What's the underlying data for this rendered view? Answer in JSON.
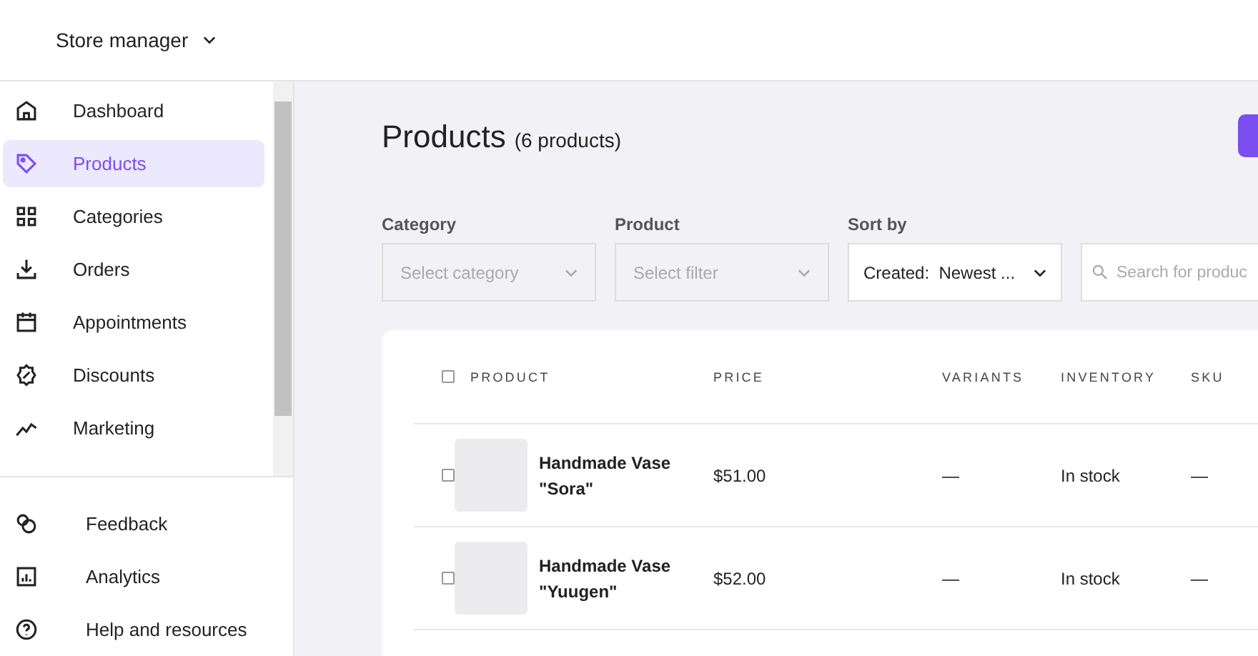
{
  "header": {
    "store_menu": "Store manager"
  },
  "sidebar": {
    "items": [
      {
        "label": "Dashboard",
        "selected": false
      },
      {
        "label": "Products",
        "selected": true
      },
      {
        "label": "Categories",
        "selected": false
      },
      {
        "label": "Orders",
        "selected": false
      },
      {
        "label": "Appointments",
        "selected": false
      },
      {
        "label": "Discounts",
        "selected": false
      },
      {
        "label": "Marketing",
        "selected": false
      }
    ],
    "footer_items": [
      {
        "label": "Feedback"
      },
      {
        "label": "Analytics"
      },
      {
        "label": "Help and resources"
      }
    ]
  },
  "page": {
    "title": "Products",
    "count": "(6 products)"
  },
  "filters": [
    {
      "kind": "select",
      "label": "Category",
      "placeholder": "Select category"
    },
    {
      "kind": "select",
      "label": "Product",
      "placeholder": "Select filter"
    },
    {
      "kind": "sort",
      "label": "Sort by",
      "prefix": "Created:",
      "value": "Newest ..."
    },
    {
      "kind": "search",
      "placeholder": "Search for produc"
    }
  ],
  "table": {
    "select_all_checked": false,
    "columns": [
      "PRODUCT",
      "PRICE",
      "VARIANTS",
      "INVENTORY",
      "SKU"
    ],
    "rows": [
      {
        "checked": false,
        "name": "Handmade Vase \"Sora\"",
        "price": "$51.00",
        "variants": "—",
        "inventory": "In stock",
        "sku": "—"
      },
      {
        "checked": false,
        "name": "Handmade Vase \"Yuugen\"",
        "price": "$52.00",
        "variants": "—",
        "inventory": "In stock",
        "sku": "—"
      }
    ]
  }
}
